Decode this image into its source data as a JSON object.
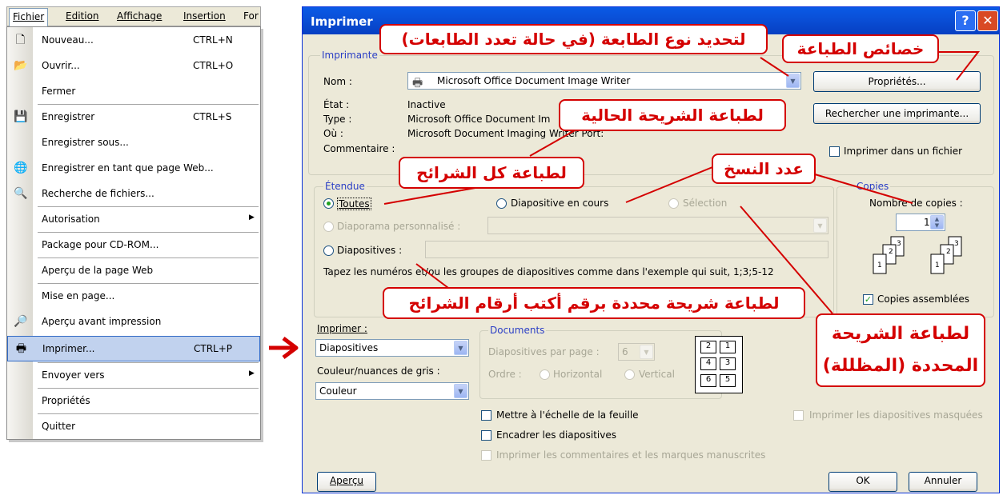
{
  "menubar": {
    "items": [
      "Fichier",
      "Edition",
      "Affichage",
      "Insertion",
      "For"
    ]
  },
  "menu": {
    "items": [
      {
        "label": "Nouveau...",
        "shortcut": "CTRL+N",
        "icon": "new-document-icon"
      },
      {
        "label": "Ouvrir...",
        "shortcut": "CTRL+O",
        "icon": "open-folder-icon"
      },
      {
        "label": "Fermer",
        "shortcut": "",
        "icon": ""
      },
      {
        "label": "Enregistrer",
        "shortcut": "CTRL+S",
        "icon": "save-disk-icon"
      },
      {
        "label": "Enregistrer sous...",
        "shortcut": "",
        "icon": ""
      },
      {
        "label": "Enregistrer en tant que page Web...",
        "shortcut": "",
        "icon": "save-web-icon"
      },
      {
        "label": "Recherche de fichiers...",
        "shortcut": "",
        "icon": "file-search-icon"
      },
      {
        "label": "Autorisation",
        "shortcut": "",
        "icon": "",
        "submenu": true
      },
      {
        "label": "Package pour CD-ROM...",
        "shortcut": "",
        "icon": ""
      },
      {
        "label": "Aperçu de la page Web",
        "shortcut": "",
        "icon": ""
      },
      {
        "label": "Mise en page...",
        "shortcut": "",
        "icon": ""
      },
      {
        "label": "Aperçu avant impression",
        "shortcut": "",
        "icon": "print-preview-icon"
      },
      {
        "label": "Imprimer...",
        "shortcut": "CTRL+P",
        "icon": "printer-icon"
      },
      {
        "label": "Envoyer vers",
        "shortcut": "",
        "icon": "",
        "submenu": true
      },
      {
        "label": "Propriétés",
        "shortcut": "",
        "icon": ""
      },
      {
        "label": "Quitter",
        "shortcut": "",
        "icon": ""
      }
    ]
  },
  "dialog": {
    "title": "Imprimer",
    "help": "?",
    "close": "✕",
    "printer_group": "Imprimante",
    "name_label": "Nom :",
    "printer_name": "Microsoft Office Document Image Writer",
    "properties_button": "Propriétés...",
    "find_printer_button": "Rechercher une imprimante...",
    "state_label": "État :",
    "state_value": "Inactive",
    "type_label": "Type :",
    "type_value": "Microsoft Office Document Im",
    "where_label": "Où :",
    "where_value": "Microsoft Document Imaging Writer Port:",
    "comment_label": "Commentaire :",
    "print_to_file": "Imprimer dans un fichier",
    "range_group": "Étendue",
    "range_all": "Toutes",
    "range_current": "Diapositive en cours",
    "range_selection": "Sélection",
    "range_custom": "Diaporama personnalisé :",
    "range_slides": "Diapositives :",
    "range_hint": "Tapez les numéros et/ou les groupes de diapositives comme dans l'exemple qui suit, 1;3;5-12",
    "copies_group": "Copies",
    "copies_label": "Nombre de copies :",
    "copies_value": "1",
    "collate": "Copies assemblées",
    "print_what_label": "Imprimer :",
    "print_what_value": "Diapositives",
    "color_label": "Couleur/nuances de gris :",
    "color_value": "Couleur",
    "documents_group": "Documents",
    "per_page_label": "Diapositives par page :",
    "per_page_value": "6",
    "order_label": "Ordre :",
    "order_horizontal": "Horizontal",
    "order_vertical": "Vertical",
    "fit_to_page": "Mettre à l'échelle de la feuille",
    "frame_slides": "Encadrer les diapositives",
    "print_comments": "Imprimer les commentaires et les marques manuscrites",
    "print_hidden": "Imprimer les diapositives masquées",
    "preview_button": "Aperçu",
    "ok_button": "OK",
    "cancel_button": "Annuler",
    "layout_numbers": [
      "2",
      "1",
      "4",
      "3",
      "6",
      "5"
    ]
  },
  "annotations": {
    "printer_type": "لتحديد نوع الطابعة (في حالة تعدد الطابعات)",
    "printer_props": "خصائص الطباعة",
    "current_slide": "لطباعة الشريحة الحالية",
    "all_slides": "لطباعة كل الشرائح",
    "copies_count": "عدد النسخ",
    "specific_slides": "لطباعة شريحة محددة برقم أكتب أرقام الشرائح",
    "selected_slide_line1": "لطباعة الشريحة",
    "selected_slide_line2": "المحددة (المظللة)"
  },
  "colors": {
    "annotation_red": "#d40000",
    "title_blue": "#0a50d8",
    "dialog_bg": "#ece9d8",
    "group_title": "#2a3ec5"
  }
}
